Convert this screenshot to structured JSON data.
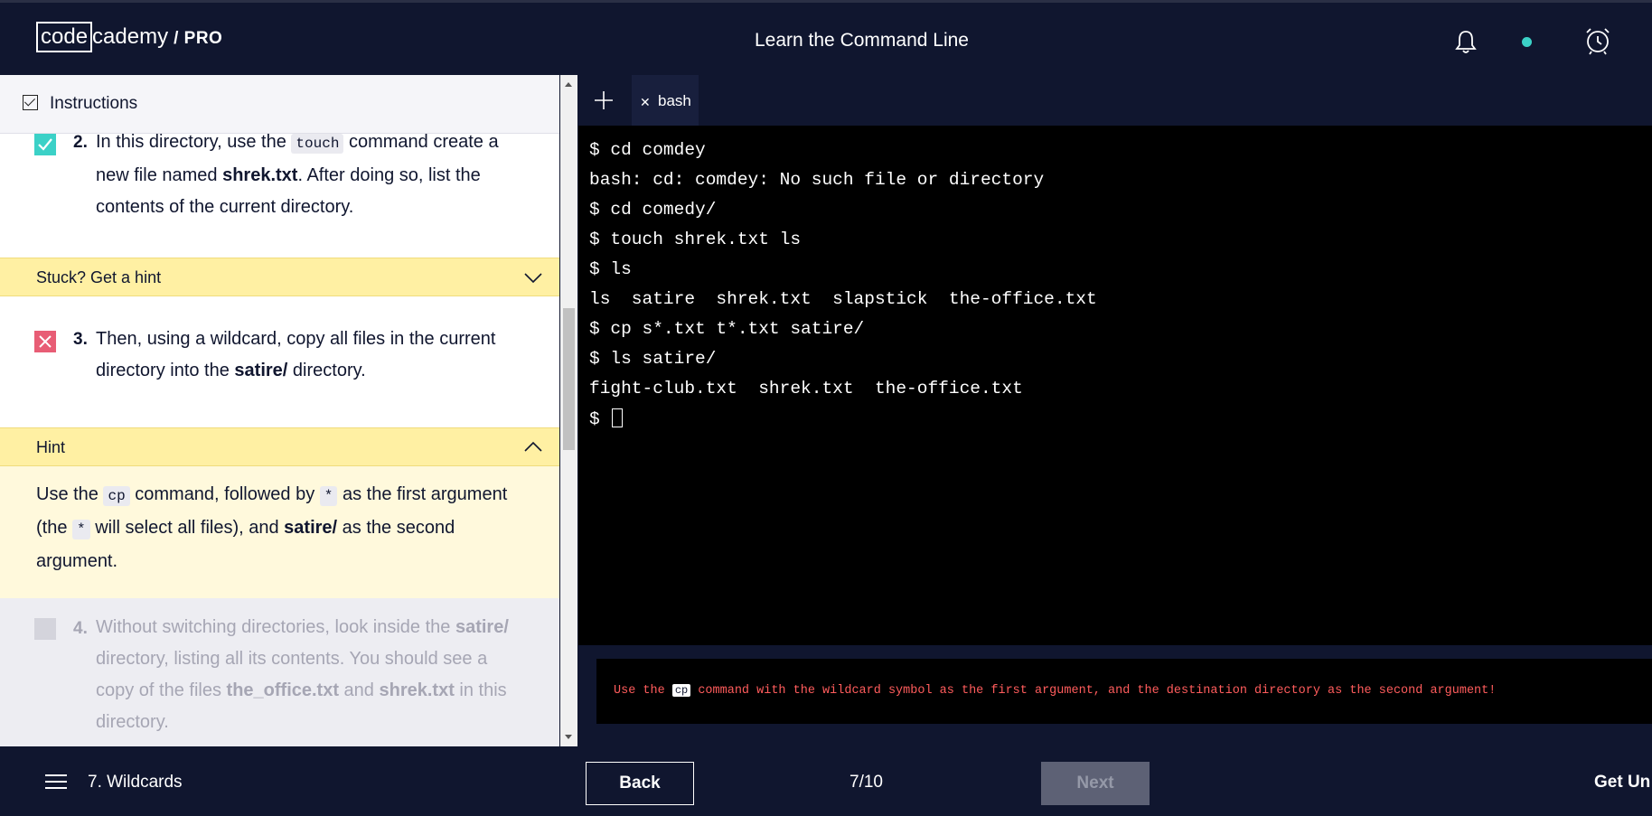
{
  "header": {
    "logo_code": "code",
    "logo_cademy": "cademy",
    "logo_pro": "/ PRO",
    "title": "Learn the Command Line"
  },
  "instructions": {
    "label": "Instructions",
    "task2": {
      "num": "2.",
      "text_a": "In this directory, use the ",
      "code": "touch",
      "text_b": " command create a new file named ",
      "bold": "shrek.txt",
      "text_c": ". After doing so, list the contents of the current directory.",
      "status": "done"
    },
    "hint2": {
      "label": "Stuck? Get a hint",
      "state": "collapsed"
    },
    "task3": {
      "num": "3.",
      "text_a": "Then, using a wildcard, copy all files in the current directory into the ",
      "bold": "satire/",
      "text_b": " directory.",
      "status": "failed"
    },
    "hint3": {
      "label": "Hint",
      "state": "expanded",
      "t1": "Use the ",
      "code1": "cp",
      "t2": " command, followed by ",
      "code2": "*",
      "t3": " as the first argument (the ",
      "code3": "*",
      "t4": " will select all files), and ",
      "bold": "satire/",
      "t5": " as the second argument."
    },
    "task4": {
      "num": "4.",
      "text_a": "Without switching directories, look inside the ",
      "bold1": "satire/",
      "text_b": " directory, listing all its contents. You should see a copy of the files ",
      "bold2": "the_office.txt",
      "text_c": " and ",
      "bold3": "shrek.txt",
      "text_d": " in this directory.",
      "status": "pending"
    }
  },
  "terminal": {
    "tab_label": "bash",
    "lines": [
      "$ cd comdey",
      "bash: cd: comdey: No such file or directory",
      "$ cd comedy/",
      "$ touch shrek.txt ls",
      "$ ls",
      "ls  satire  shrek.txt  slapstick  the-office.txt",
      "$ cp s*.txt t*.txt satire/",
      "$ ls satire/",
      "fight-club.txt  shrek.txt  the-office.txt"
    ],
    "prompt": "$ "
  },
  "error": {
    "pre": "Use the ",
    "code": "cp",
    "post": " command with the wildcard symbol as the first argument, and the destination directory as the second argument!"
  },
  "footer": {
    "lesson": "7. Wildcards",
    "back": "Back",
    "progress": "7/10",
    "next": "Next",
    "upgrade": "Get Un"
  },
  "colors": {
    "navy": "#10162f",
    "hint_yellow": "#fff0a3",
    "done_teal": "#3bd1c7",
    "fail_red": "#e85d75",
    "error_red": "#ff5c5c"
  }
}
